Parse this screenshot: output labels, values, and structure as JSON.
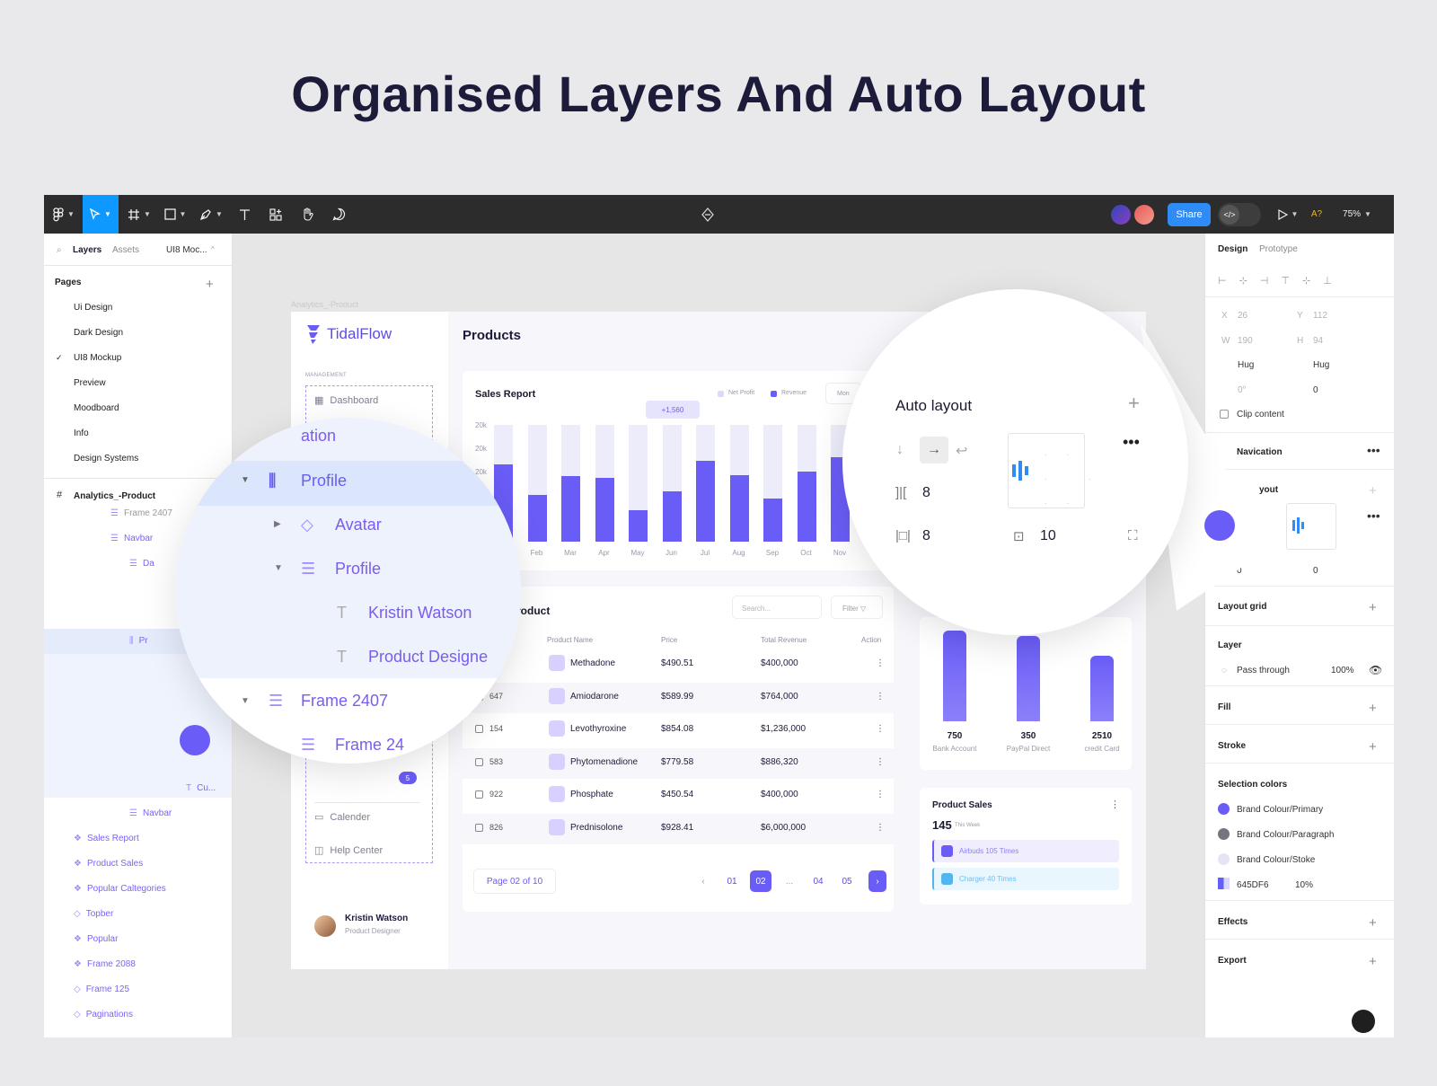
{
  "headline": "Organised Layers And Auto Layout",
  "toolbar": {
    "share": "Share",
    "zoom": "75%",
    "a_label": "A?"
  },
  "left_panel": {
    "tabs": {
      "layers": "Layers",
      "assets": "Assets",
      "file": "UI8 Moc..."
    },
    "pages_title": "Pages",
    "pages": [
      "Ui Design",
      "Dark Design",
      "UI8 Mockup",
      "Preview",
      "Moodboard",
      "Info",
      "Design Systems"
    ],
    "frame": "Analytics_-Product",
    "layers_top": [
      "Frame 2407",
      "Navbar",
      "Da",
      "Pr"
    ],
    "layers_bottom": [
      "Cu...",
      "Navbar",
      "Sales Report",
      "Product Sales",
      "Popular Caltegories",
      "Topber",
      "Popular",
      "Frame 2088",
      "Frame 125",
      "Paginations"
    ]
  },
  "right_panel": {
    "tabs": {
      "design": "Design",
      "prototype": "Prototype"
    },
    "x_label": "X",
    "x": "26",
    "y_label": "Y",
    "y": "112",
    "w_label": "W",
    "w": "190",
    "h_label": "H",
    "h": "94",
    "hug_w": "Hug",
    "hug_h": "Hug",
    "rotation": "0°",
    "radius": "0",
    "clip": "Clip content",
    "navigation": "Navication",
    "auto_layout": "yout",
    "pad_h": "0",
    "pad_v": "0",
    "layout_grid": "Layout grid",
    "layer": "Layer",
    "blend": "Pass through",
    "opacity": "100%",
    "fill": "Fill",
    "stroke": "Stroke",
    "selection_colors": "Selection colors",
    "colors": [
      {
        "name": "Brand Colour/Primary",
        "hex": "#6a5cf6"
      },
      {
        "name": "Brand Colour/Paragraph",
        "hex": "#77737f"
      },
      {
        "name": "Brand Colour/Stoke",
        "hex": "#e6e4f2"
      }
    ],
    "hex_value": "645DF6",
    "hex_pct": "10%",
    "effects": "Effects",
    "export": "Export"
  },
  "app": {
    "frame_label": "Analytics_-Product",
    "brand": "TidalFlow",
    "title": "Products",
    "management": "MANAGEMENT",
    "menu": {
      "dashboard": "Dashboard",
      "calendar": "Calender",
      "help": "Help Center",
      "badge": "5"
    },
    "user": {
      "name": "Kristin Watson",
      "role": "Product Designer"
    },
    "sales_report": {
      "title": "Sales Report",
      "legend": [
        "Net Profit",
        "Revenue"
      ],
      "period": "Mon",
      "tooltip": "+1,560",
      "y_ticks": [
        "20k",
        "20k",
        "20k"
      ],
      "months": [
        "Feb",
        "Mar",
        "Apr",
        "May",
        "Jun",
        "Jul",
        "Aug",
        "Sep",
        "Oct",
        "Nov"
      ]
    },
    "product_table": {
      "title": "roduct",
      "search": "Search...",
      "filter": "Filter",
      "columns": [
        "Product Name",
        "Price",
        "Total Revenue",
        "Action"
      ],
      "rows": [
        {
          "id": "",
          "name": "Methadone",
          "price": "$490.51",
          "revenue": "$400,000"
        },
        {
          "id": "647",
          "name": "Amiodarone",
          "price": "$589.99",
          "revenue": "$764,000"
        },
        {
          "id": "154",
          "name": "Levothyroxine",
          "price": "$854.08",
          "revenue": "$1,236,000"
        },
        {
          "id": "583",
          "name": "Phytomenadione",
          "price": "$779.58",
          "revenue": "$886,320"
        },
        {
          "id": "922",
          "name": "Phosphate",
          "price": "$450.54",
          "revenue": "$400,000"
        },
        {
          "id": "826",
          "name": "Prednisolone",
          "price": "$928.41",
          "revenue": "$6,000,000"
        }
      ],
      "page_text": "Page 02 of 10",
      "pages": [
        "01",
        "02",
        "...",
        "04",
        "05"
      ]
    },
    "payment": [
      {
        "value": "750",
        "label": "Bank Account",
        "fraction": 0.72
      },
      {
        "value": "350",
        "label": "PayPal Direct",
        "fraction": 0.68
      },
      {
        "value": "2510",
        "label": "credit Card",
        "fraction": 0.52
      }
    ],
    "product_sales": {
      "title": "Product Sales",
      "count": "145",
      "sub": "This Week",
      "items": [
        "Airbuds 105 Times",
        "Charger 40 Times"
      ]
    }
  },
  "chart_data": {
    "type": "bar",
    "categories": [
      "",
      "Feb",
      "Mar",
      "Apr",
      "May",
      "Jun",
      "Jul",
      "Aug",
      "Sep",
      "Oct",
      "Nov",
      ""
    ],
    "series": [
      {
        "name": "Revenue",
        "values": [
          0.66,
          0.4,
          0.56,
          0.55,
          0.27,
          0.43,
          0.69,
          0.57,
          0.37,
          0.6,
          0.72,
          0.5
        ]
      }
    ],
    "ylim": [
      0,
      1
    ]
  },
  "zoom_layers": {
    "partial": "ation",
    "items": [
      "Profile",
      "Avatar",
      "Profile",
      "Kristin Watson",
      "Product Designe",
      "Frame 2407",
      "Frame 24"
    ]
  },
  "zoom_autolayout": {
    "title": "Auto layout",
    "gap": "8",
    "pad_h": "8",
    "pad_v": "10"
  }
}
